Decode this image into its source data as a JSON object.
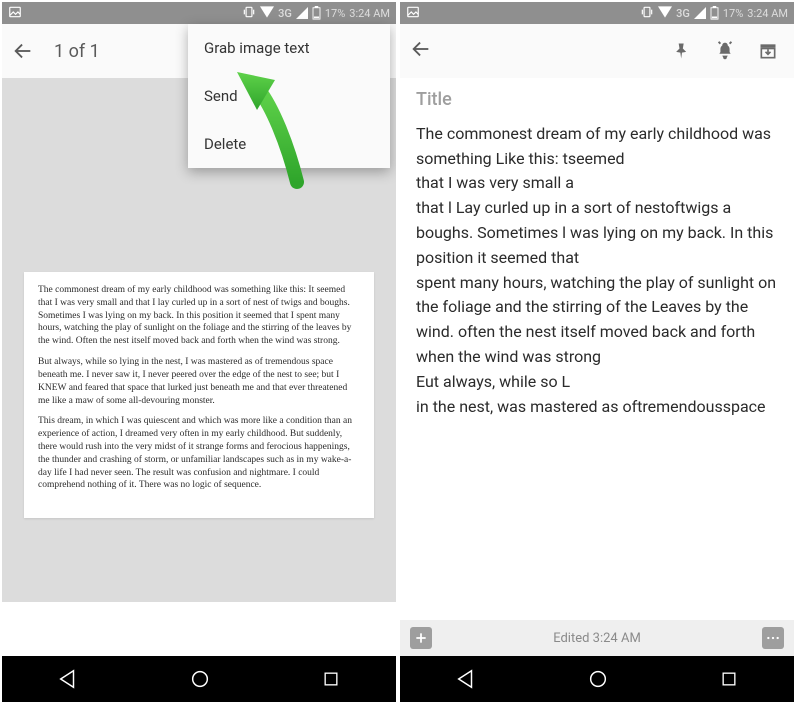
{
  "status": {
    "network_label": "3G",
    "battery_pct": "17%",
    "time": "3:24 AM"
  },
  "left": {
    "toolbar_title": "1 of 1",
    "menu": {
      "grab": "Grab image text",
      "send": "Send",
      "delete": "Delete"
    },
    "page": {
      "p1": "The commonest dream of my early childhood was something like this: It seemed that I was very small and that I lay curled up in a sort of nest of twigs and boughs. Sometimes I was lying on my back. In this position it seemed that I spent many hours, watching the play of sunlight on the foliage and the stirring of the leaves by the wind. Often the nest itself moved back and forth when the wind was strong.",
      "p2": "But always, while so lying in the nest, I was mastered as of tremendous space beneath me. I never saw it, I never peered over the edge of the nest to see; but I KNEW and feared that space that lurked just beneath me and that ever threatened me like a maw of some all-devouring monster.",
      "p3": "This dream, in which I was quiescent and which was more like a condition than an experience of action, I dreamed very often in my early childhood. But suddenly, there would rush into the very midst of it strange forms and ferocious happenings, the thunder and crashing of storm, or unfamiliar landscapes such as in my wake-a-day life I had never seen. The result was confusion and nightmare. I could comprehend nothing of it. There was no logic of sequence."
    }
  },
  "right": {
    "title_placeholder": "Title",
    "body": "The commonest dream of my early childhood was something Like this: tseemed\nthat I was very small a\nthat l Lay curled up in a sort of nestoftwigs a\nboughs. Sometimes l was lying on my back. In this position it seemed that\nspent many hours, watching the play of sunlight on the foliage and the stirring of the Leaves by the wind. often the nest itself moved back and forth when the wind was strong\nEut always, while so L\nin the nest, was mastered as oftremendousspace",
    "footer_text": "Edited 3:24 AM"
  }
}
